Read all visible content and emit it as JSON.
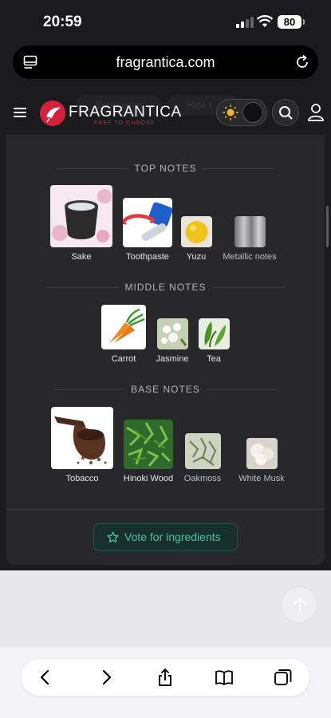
{
  "status_bar": {
    "time": "20:59",
    "battery": "80"
  },
  "browser": {
    "url": "fragrantica.com"
  },
  "site_header": {
    "brand": "FRAGRANTICA",
    "tagline": "FREE TO CHOOSE",
    "show_votes": "Show votes",
    "hide_label": "Hide l"
  },
  "notes": {
    "top_title": "TOP NOTES",
    "top": [
      {
        "label": "Sake",
        "icon": "sake-cup"
      },
      {
        "label": "Toothpaste",
        "icon": "toothpaste"
      },
      {
        "label": "Yuzu",
        "icon": "yuzu"
      },
      {
        "label": "Metallic notes",
        "icon": "metal"
      }
    ],
    "middle_title": "MIDDLE NOTES",
    "middle": [
      {
        "label": "Carrot",
        "icon": "carrot"
      },
      {
        "label": "Jasmine",
        "icon": "jasmine"
      },
      {
        "label": "Tea",
        "icon": "tea-leaves"
      }
    ],
    "base_title": "BASE NOTES",
    "base": [
      {
        "label": "Tobacco",
        "icon": "tobacco-pipe"
      },
      {
        "label": "Hinoki Wood",
        "icon": "hinoki"
      },
      {
        "label": "Oakmoss",
        "icon": "oakmoss"
      },
      {
        "label": "White Musk",
        "icon": "white-musk"
      }
    ]
  },
  "vote_button": "Vote for ingredients",
  "colors": {
    "accent": "#45c3a6",
    "brand": "#d3213c",
    "card": "#28282b"
  }
}
